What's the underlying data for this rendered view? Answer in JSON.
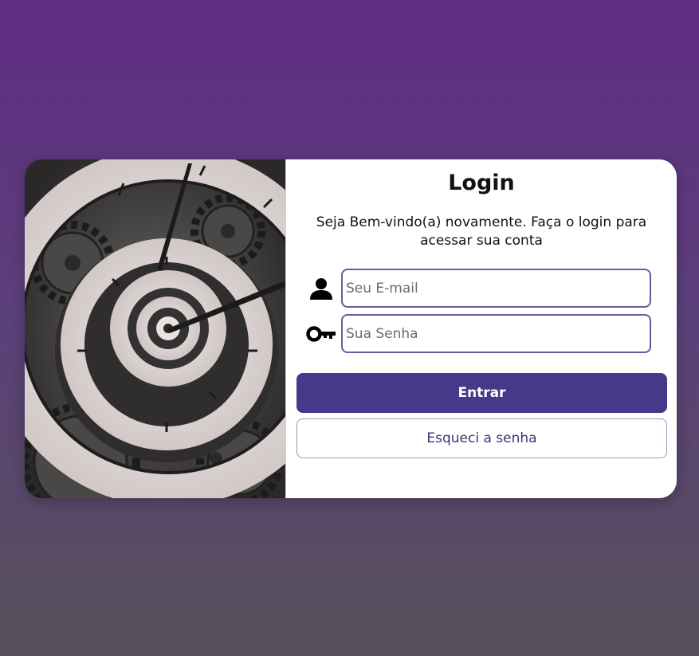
{
  "login": {
    "title": "Login",
    "subtitle": "Seja Bem-vindo(a) novamente. Faça o login para acessar sua conta",
    "email_placeholder": "Seu E-mail",
    "email_value": "",
    "password_placeholder": "Sua Senha",
    "password_value": "",
    "submit_label": "Entrar",
    "forgot_label": "Esqueci a senha"
  },
  "icons": {
    "email": "user-icon",
    "password": "key-icon"
  },
  "colors": {
    "primary_button": "#46398a",
    "input_border": "#6a5a9c",
    "background_top": "#612c83",
    "background_bottom": "#56505a"
  }
}
